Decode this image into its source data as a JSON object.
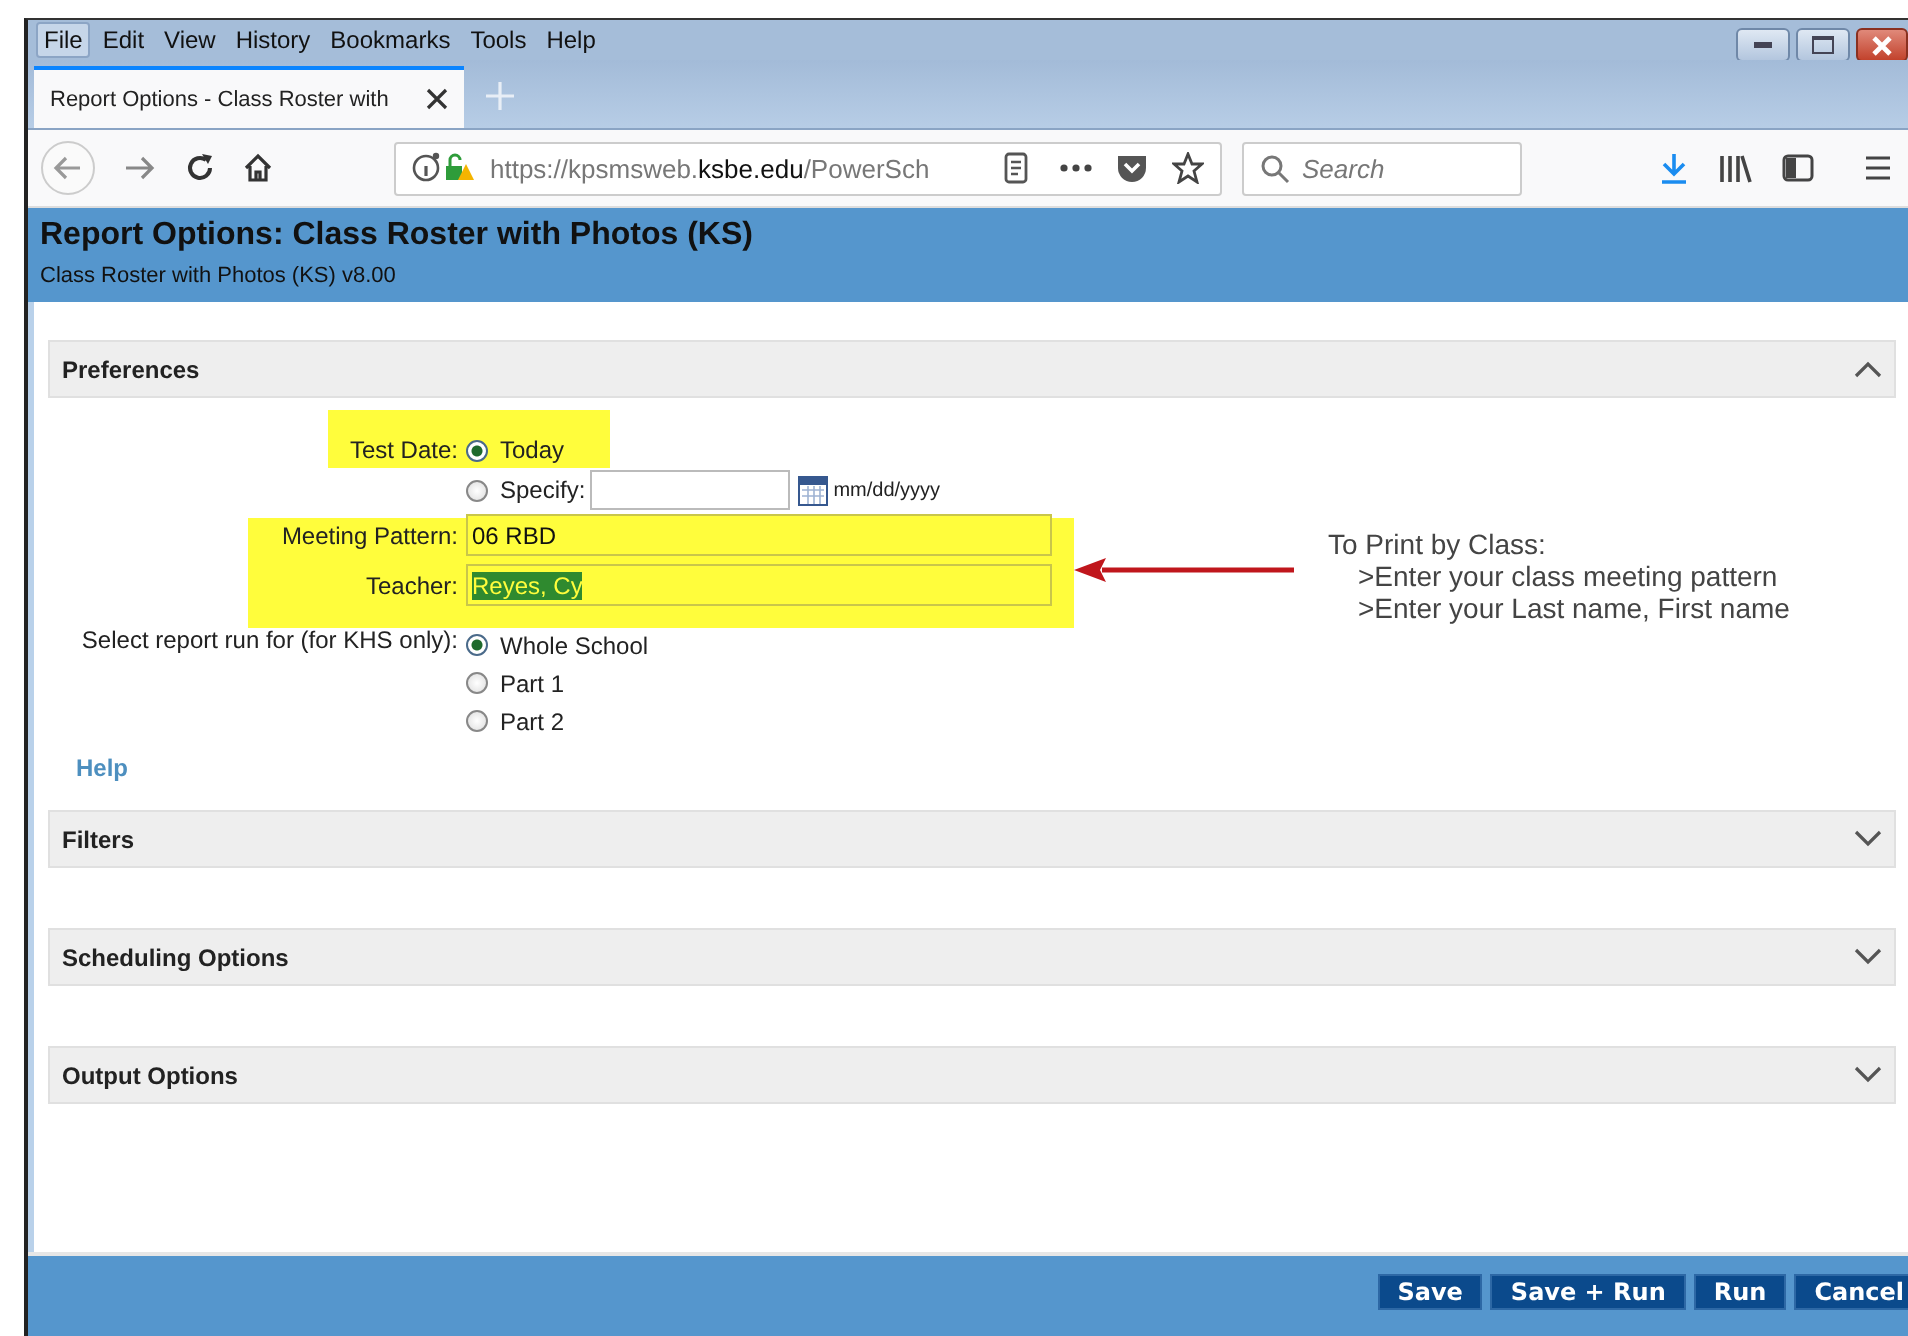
{
  "menu_bar": [
    {
      "label": "File",
      "selected": true
    },
    {
      "label": "Edit",
      "selected": false
    },
    {
      "label": "View",
      "selected": false
    },
    {
      "label": "History",
      "selected": false
    },
    {
      "label": "Bookmarks",
      "selected": false
    },
    {
      "label": "Tools",
      "selected": false
    },
    {
      "label": "Help",
      "selected": false
    }
  ],
  "tab": {
    "title": "Report Options - Class Roster with"
  },
  "address_bar": {
    "scheme_host": "https://kpsmsweb.",
    "domain": "ksbe.edu",
    "path": "/PowerSch"
  },
  "search": {
    "placeholder": "Search"
  },
  "header": {
    "title": "Report Options: Class Roster with Photos (KS)",
    "subtitle": "Class Roster with Photos (KS) v8.00"
  },
  "sections": [
    {
      "title": "Preferences",
      "expanded": true
    },
    {
      "title": "Filters",
      "expanded": false
    },
    {
      "title": "Scheduling Options",
      "expanded": false
    },
    {
      "title": "Output Options",
      "expanded": false
    }
  ],
  "preferences": {
    "test_date": {
      "label": "Test Date:",
      "options": [
        {
          "label": "Today",
          "selected": true
        },
        {
          "label": "Specify:",
          "selected": false
        }
      ],
      "date_hint": "mm/dd/yyyy"
    },
    "meeting_pattern": {
      "label": "Meeting Pattern:",
      "value": "06 RBD"
    },
    "teacher": {
      "label": "Teacher:",
      "value": "Reyes, Cy"
    },
    "report_run": {
      "label": "Select report run for (for KHS only):",
      "options": [
        {
          "label": "Whole School",
          "selected": true
        },
        {
          "label": "Part 1",
          "selected": false
        },
        {
          "label": "Part 2",
          "selected": false
        }
      ]
    },
    "help": "Help"
  },
  "note": {
    "title": "To Print by Class:",
    "lines": [
      ">Enter your class meeting pattern",
      ">Enter your Last name, First name"
    ]
  },
  "buttons": [
    "Save",
    "Save + Run",
    "Run",
    "Cancel"
  ]
}
